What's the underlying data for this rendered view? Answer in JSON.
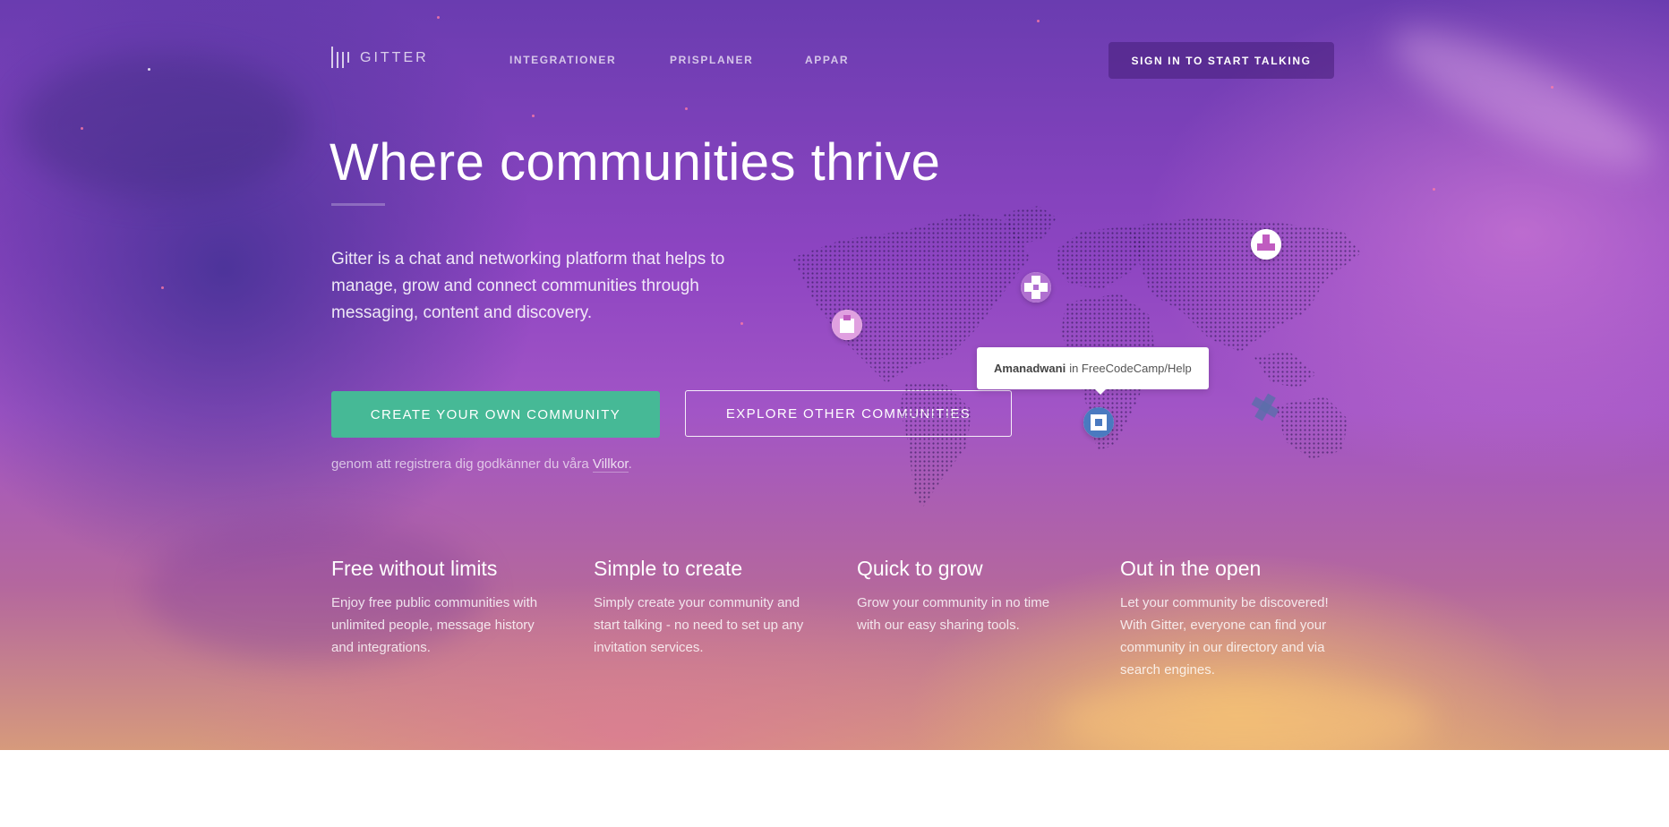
{
  "nav": {
    "logo_text": "GITTER",
    "links": [
      "INTEGRATIONER",
      "PRISPLANER",
      "APPAR"
    ],
    "signin_label": "SIGN IN TO START TALKING"
  },
  "hero": {
    "headline": "Where communities thrive",
    "lead": "Gitter is a chat and networking platform that helps to manage, grow and connect communities through messaging, content and discovery.",
    "primary_button": "CREATE YOUR OWN COMMUNITY",
    "secondary_button": "EXPLORE OTHER COMMUNITIES",
    "terms_prefix": "genom att registrera dig godkänner du våra",
    "terms_link": "Villkor",
    "terms_suffix": "."
  },
  "map": {
    "tooltip_user": "Amanadwani",
    "tooltip_room": "in FreeCodeCamp/Help"
  },
  "features": [
    {
      "title": "Free without limits",
      "text": "Enjoy free public communities with unlimited people, message history and integrations."
    },
    {
      "title": "Simple to create",
      "text": "Simply create your community and start talking - no need to set up any invitation services."
    },
    {
      "title": "Quick to grow",
      "text": "Grow your community in no time with our easy sharing tools."
    },
    {
      "title": "Out in the open",
      "text": "Let your community be discovered! With Gitter, everyone can find your community in our directory and via search engines."
    }
  ],
  "colors": {
    "primary_button": "#46b996",
    "hero_top": "#6a3cb0",
    "hero_bottom": "#d69a7c"
  }
}
